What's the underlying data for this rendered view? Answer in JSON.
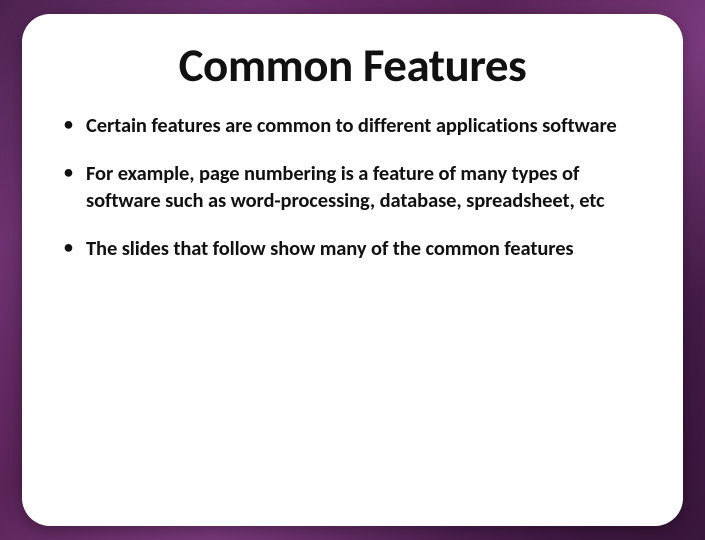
{
  "slide": {
    "title": "Common Features",
    "bullets": [
      "Certain features are common to different applications software",
      "For example, page numbering is a feature of many types of software such as word-processing, database, spreadsheet, etc",
      "The slides that follow show many of the common features"
    ]
  }
}
